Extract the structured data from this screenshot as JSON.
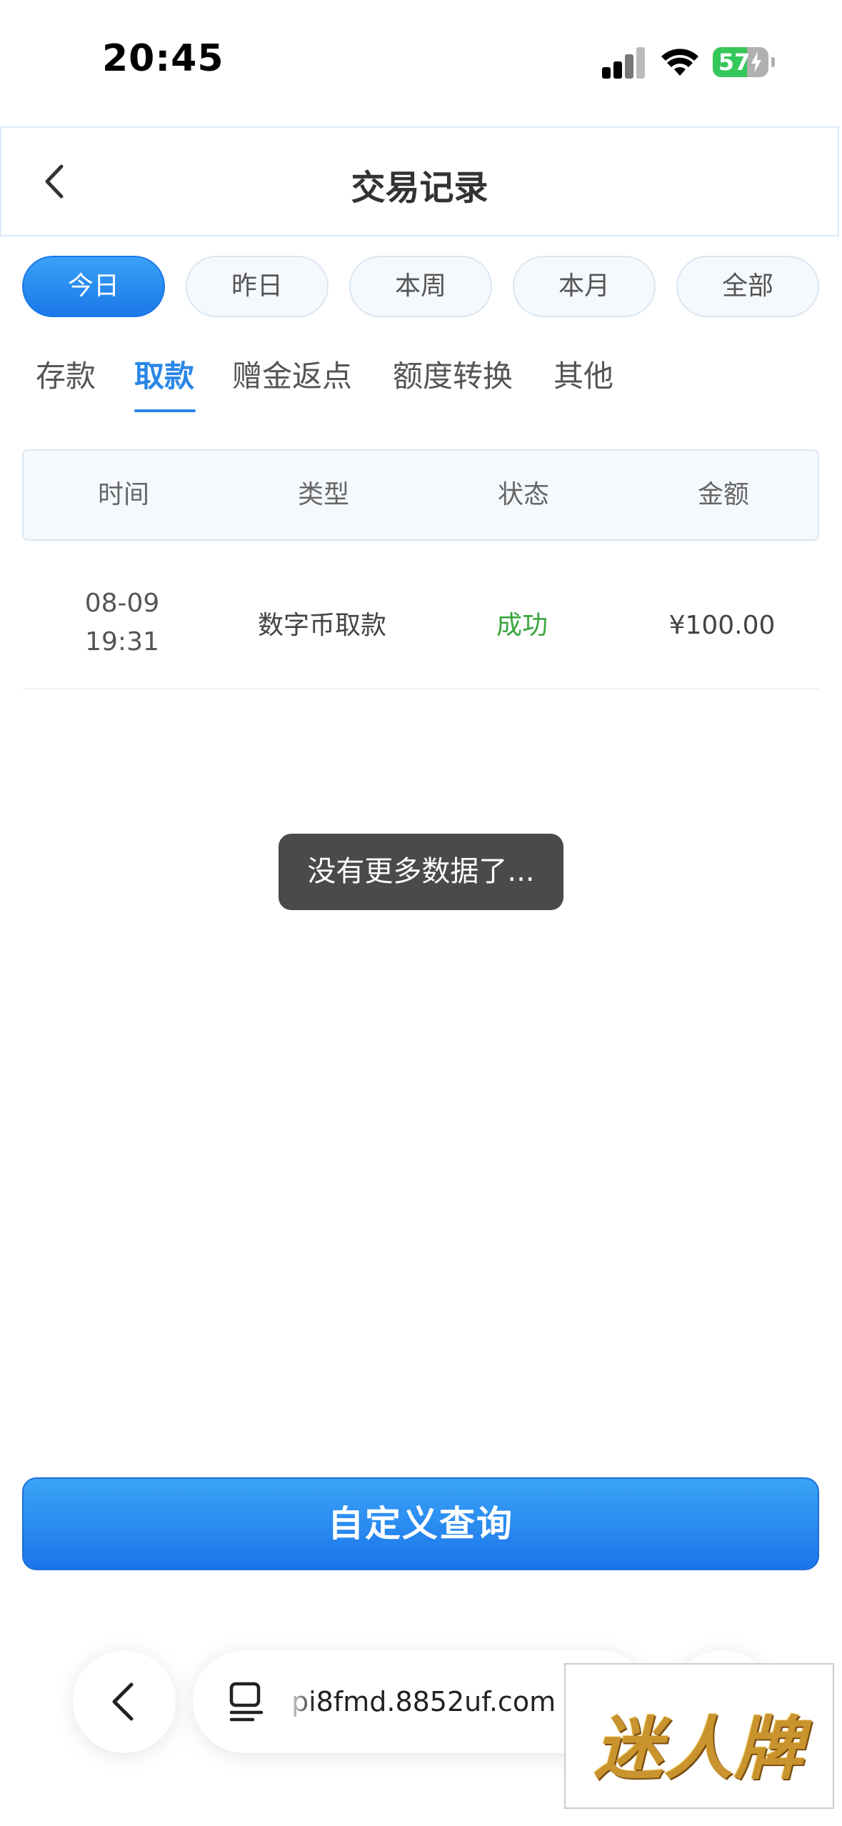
{
  "status_bar": {
    "time": "20:45",
    "battery_level": 57
  },
  "header": {
    "title": "交易记录"
  },
  "date_filters": [
    {
      "label": "今日",
      "active": true
    },
    {
      "label": "昨日",
      "active": false
    },
    {
      "label": "本周",
      "active": false
    },
    {
      "label": "本月",
      "active": false
    },
    {
      "label": "全部",
      "active": false
    }
  ],
  "category_tabs": [
    {
      "label": "存款",
      "active": false
    },
    {
      "label": "取款",
      "active": true
    },
    {
      "label": "赠金返点",
      "active": false
    },
    {
      "label": "额度转换",
      "active": false
    },
    {
      "label": "其他",
      "active": false
    }
  ],
  "table": {
    "columns": [
      "时间",
      "类型",
      "状态",
      "金额"
    ],
    "rows": [
      {
        "date": "08-09",
        "time": "19:31",
        "type": "数字币取款",
        "status": "成功",
        "amount": "¥100.00"
      }
    ]
  },
  "toast": "没有更多数据了...",
  "query_button": "自定义查询",
  "browser": {
    "url": "pi8fmd.8852uf.com"
  },
  "watermark": "迷人牌",
  "colors": {
    "accent": "#1b78ea",
    "active_tab": "#2a86e6",
    "success": "#3aa63e",
    "toast_bg": "#4a4a4a"
  }
}
